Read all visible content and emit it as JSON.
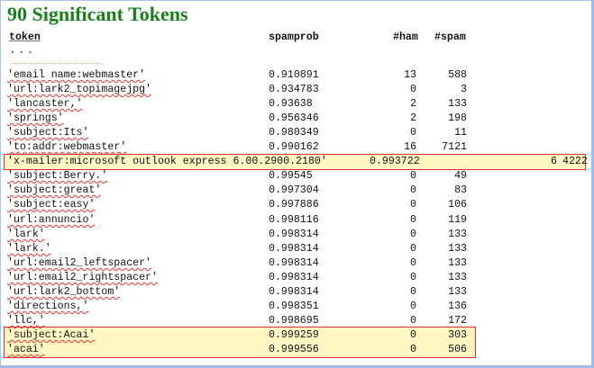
{
  "title": "90 Significant Tokens",
  "headers": {
    "token": "token",
    "spamprob": "spamprob",
    "ham": "#ham",
    "spam": "#spam"
  },
  "ellipsis": "...",
  "rows": [
    {
      "token": "'email name:webmaster'",
      "spamprob": "0.910891",
      "ham": "13",
      "spam": "588",
      "highlight": false
    },
    {
      "token": "'url:lark2_topimagejpg'",
      "spamprob": "0.934783",
      "ham": "0",
      "spam": "3",
      "highlight": false
    },
    {
      "token": "'lancaster,'",
      "spamprob": "0.93638",
      "ham": "2",
      "spam": "133",
      "highlight": false
    },
    {
      "token": "'springs'",
      "spamprob": "0.956346",
      "ham": "2",
      "spam": "198",
      "highlight": false
    },
    {
      "token": "'subject:Its'",
      "spamprob": "0.980349",
      "ham": "0",
      "spam": "11",
      "highlight": false
    },
    {
      "token": "'to:addr:webmaster'",
      "spamprob": "0.990162",
      "ham": "16",
      "spam": "7121",
      "highlight": false
    },
    {
      "token": "'x-mailer:microsoft outlook express 6.00.2900.2180'",
      "spamprob": "0.993722",
      "ham": "6",
      "spam": "4222",
      "highlight": true,
      "wide": true
    },
    {
      "token": "'subject:Berry.'",
      "spamprob": "0.99545",
      "ham": "0",
      "spam": "49",
      "highlight": false
    },
    {
      "token": "'subject:great'",
      "spamprob": "0.997304",
      "ham": "0",
      "spam": "83",
      "highlight": false
    },
    {
      "token": "'subject:easy'",
      "spamprob": "0.997886",
      "ham": "0",
      "spam": "106",
      "highlight": false
    },
    {
      "token": "'url:annuncio'",
      "spamprob": "0.998116",
      "ham": "0",
      "spam": "119",
      "highlight": false
    },
    {
      "token": "'lark'",
      "spamprob": "0.998314",
      "ham": "0",
      "spam": "133",
      "highlight": false
    },
    {
      "token": "'lark.'",
      "spamprob": "0.998314",
      "ham": "0",
      "spam": "133",
      "highlight": false
    },
    {
      "token": "'url:email2_leftspacer'",
      "spamprob": "0.998314",
      "ham": "0",
      "spam": "133",
      "highlight": false
    },
    {
      "token": "'url:email2_rightspacer'",
      "spamprob": "0.998314",
      "ham": "0",
      "spam": "133",
      "highlight": false
    },
    {
      "token": "'url:lark2_bottom'",
      "spamprob": "0.998314",
      "ham": "0",
      "spam": "133",
      "highlight": false
    },
    {
      "token": "'directions,'",
      "spamprob": "0.998351",
      "ham": "0",
      "spam": "136",
      "highlight": false
    },
    {
      "token": "'llc,'",
      "spamprob": "0.998695",
      "ham": "0",
      "spam": "172",
      "highlight": false
    },
    {
      "token": "'subject:Acai'",
      "spamprob": "0.999259",
      "ham": "0",
      "spam": "303",
      "highlight": true
    },
    {
      "token": "'acai'",
      "spamprob": "0.999556",
      "ham": "0",
      "spam": "506",
      "highlight": true
    }
  ],
  "colors": {
    "title": "#17811c",
    "highlight_bg": "#fff6c4",
    "highlight_border": "#d93030",
    "ellipsis": "#2a6ee0"
  }
}
